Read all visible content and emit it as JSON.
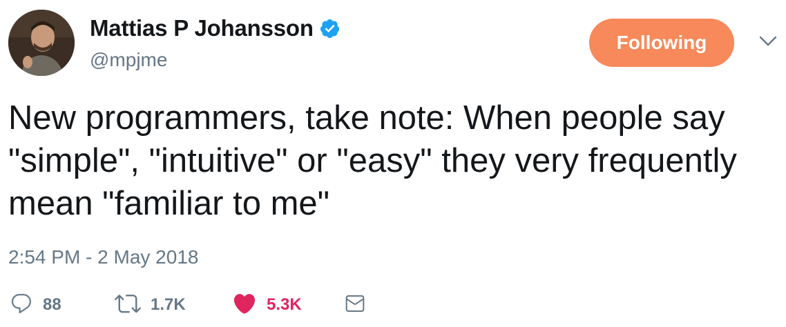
{
  "colors": {
    "follow_button": "#f7895a",
    "verified": "#1da1f2",
    "like": "#e0245e",
    "secondary_text": "#657786",
    "primary_text": "#14171a"
  },
  "author": {
    "display_name": "Mattias P Johansson",
    "handle": "@mpjme",
    "verified": true,
    "avatar_icon": "avatar-photo"
  },
  "follow_button": {
    "label": "Following"
  },
  "menu": {
    "icon": "chevron-down-icon"
  },
  "tweet": {
    "text": "New programmers, take note: When people say \"simple\", \"intuitive\" or \"easy\" they very frequently mean \"familiar to me\"",
    "timestamp": "2:54 PM - 2 May 2018"
  },
  "actions": {
    "reply": {
      "icon": "reply-icon",
      "count": "88"
    },
    "retweet": {
      "icon": "retweet-icon",
      "count": "1.7K"
    },
    "like": {
      "icon": "heart-icon",
      "count": "5.3K",
      "liked": true
    },
    "dm": {
      "icon": "envelope-icon"
    }
  }
}
